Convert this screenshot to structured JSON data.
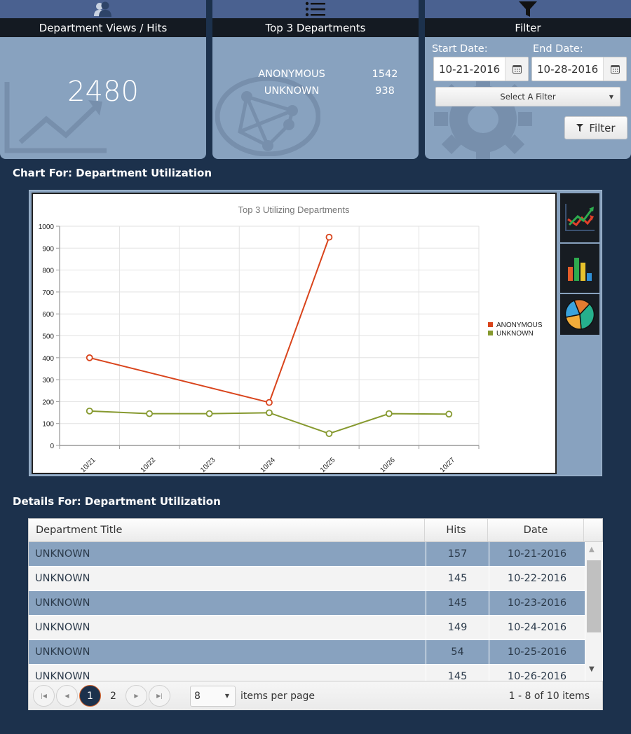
{
  "cards": {
    "views": {
      "title": "Department Views / Hits",
      "value": "2480",
      "icon": "users-icon"
    },
    "top3": {
      "title": "Top 3 Departments",
      "icon": "star-list-icon",
      "rows": [
        {
          "name": "ANONYMOUS",
          "value": "1542"
        },
        {
          "name": "UNKNOWN",
          "value": "938"
        }
      ]
    },
    "filter": {
      "title": "Filter",
      "icon": "funnel-icon",
      "start_label": "Start Date:",
      "start_value": "10-21-2016",
      "end_label": "End Date:",
      "end_value": "10-28-2016",
      "select_placeholder": "Select A Filter",
      "button_label": "Filter"
    }
  },
  "chart_section": {
    "title": "Chart For: Department Utilization"
  },
  "chart_types": [
    "line-chart-icon",
    "bar-chart-icon",
    "pie-chart-icon"
  ],
  "chart_data": {
    "type": "line",
    "title": "Top 3 Utilizing Departments",
    "xlabel": "",
    "ylabel": "",
    "categories": [
      "10/21",
      "10/22",
      "10/23",
      "10/24",
      "10/25",
      "10/26",
      "10/27"
    ],
    "ylim": [
      0,
      1000
    ],
    "yticks": [
      0,
      100,
      200,
      300,
      400,
      500,
      600,
      700,
      800,
      900,
      1000
    ],
    "grid": true,
    "legend_position": "right",
    "series": [
      {
        "name": "ANONYMOUS",
        "color": "#d9441c",
        "values": [
          400,
          null,
          null,
          196,
          950,
          null,
          null
        ]
      },
      {
        "name": "UNKNOWN",
        "color": "#86992f",
        "values": [
          157,
          145,
          145,
          149,
          54,
          145,
          143
        ]
      }
    ]
  },
  "details_section": {
    "title": "Details For: Department Utilization"
  },
  "table": {
    "columns": [
      "Department Title",
      "Hits",
      "Date"
    ],
    "rows": [
      [
        "UNKNOWN",
        "157",
        "10-21-2016"
      ],
      [
        "UNKNOWN",
        "145",
        "10-22-2016"
      ],
      [
        "UNKNOWN",
        "145",
        "10-23-2016"
      ],
      [
        "UNKNOWN",
        "149",
        "10-24-2016"
      ],
      [
        "UNKNOWN",
        "54",
        "10-25-2016"
      ],
      [
        "UNKNOWN",
        "145",
        "10-26-2016"
      ]
    ]
  },
  "pager": {
    "pages": [
      "1",
      "2"
    ],
    "current_page": "1",
    "page_size": "8",
    "page_size_label": "items per page",
    "info": "1 - 8 of 10 items"
  }
}
